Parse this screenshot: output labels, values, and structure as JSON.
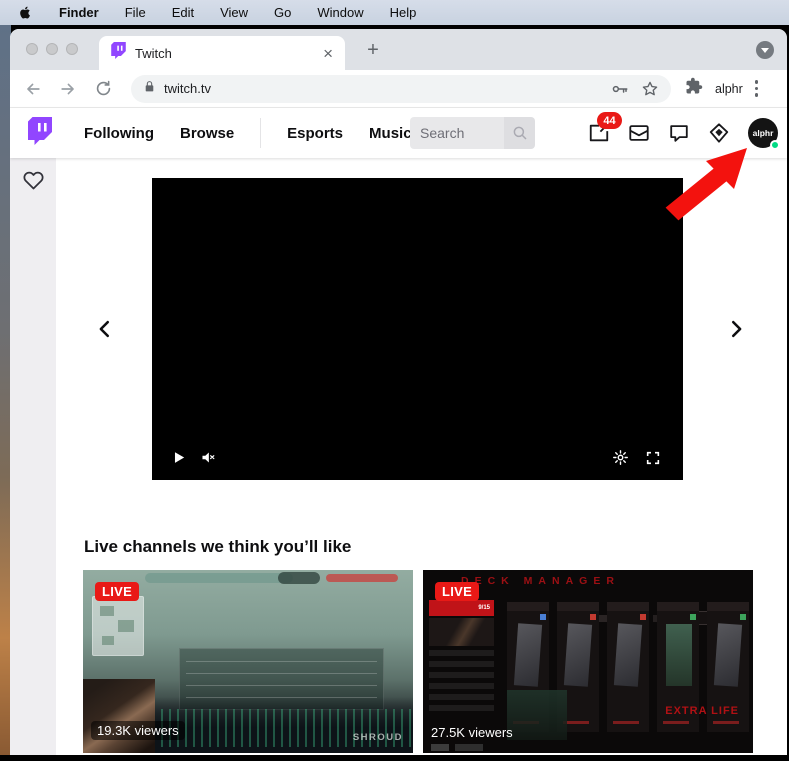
{
  "menubar": {
    "app_name": "Finder",
    "items": [
      "File",
      "Edit",
      "View",
      "Go",
      "Window",
      "Help"
    ]
  },
  "browser": {
    "tab_title": "Twitch",
    "close_label": "×",
    "new_tab_label": "+",
    "url": "twitch.tv",
    "profile_name": "alphr"
  },
  "twitch": {
    "nav_items": [
      "Following",
      "Browse",
      "Esports",
      "Music"
    ],
    "search_placeholder": "Search",
    "notification_count": "44",
    "avatar_label": "alphr",
    "section_title": "Live channels we think you’ll like",
    "streams": [
      {
        "live_label": "LIVE",
        "viewers": "19.3K viewers",
        "watermark": "SHROUD"
      },
      {
        "live_label": "LIVE",
        "viewers": "27.5K viewers",
        "watermark": "EXTRA LIFE",
        "game_screen_title": "DECK MANAGER",
        "deck_badge": "9/15"
      }
    ]
  },
  "colors": {
    "twitch_purple": "#9146FF",
    "live_red": "#e91916",
    "online_green": "#00db84",
    "arrow_red": "#f3120e"
  }
}
